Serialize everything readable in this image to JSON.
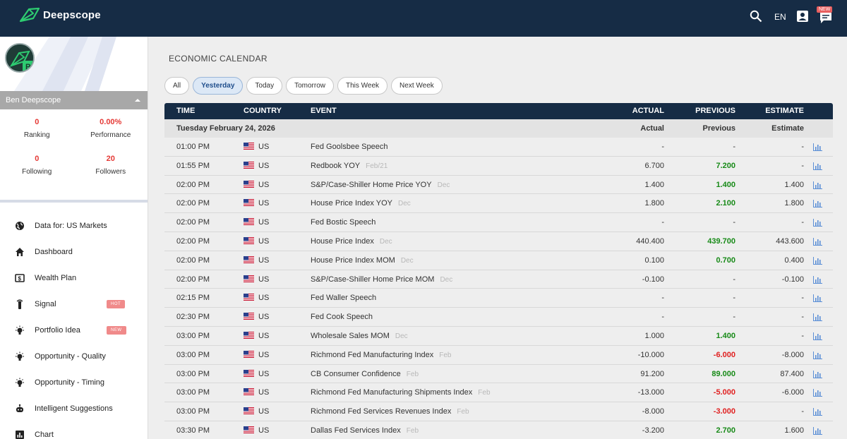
{
  "header": {
    "app_name": "Deepscope",
    "language": "EN",
    "new_badge": "NEW"
  },
  "sidebar": {
    "username": "Ben Deepscope",
    "stats": [
      {
        "value": "0",
        "label": "Ranking"
      },
      {
        "value": "0.00%",
        "label": "Performance"
      },
      {
        "value": "0",
        "label": "Following"
      },
      {
        "value": "20",
        "label": "Followers"
      }
    ],
    "items": [
      {
        "label": "Data for: US Markets",
        "icon": "globe-icon"
      },
      {
        "label": "Dashboard",
        "icon": "home-icon"
      },
      {
        "label": "Wealth Plan",
        "icon": "wallet-icon"
      },
      {
        "label": "Signal",
        "icon": "signal-icon",
        "badge": "HOT"
      },
      {
        "label": "Portfolio Idea",
        "icon": "lightbulb-icon",
        "badge": "NEW"
      },
      {
        "label": "Opportunity - Quality",
        "icon": "lightbulb-icon"
      },
      {
        "label": "Opportunity - Timing",
        "icon": "lightbulb-icon"
      },
      {
        "label": "Intelligent Suggestions",
        "icon": "robot-icon"
      },
      {
        "label": "Chart",
        "icon": "chart-icon"
      }
    ]
  },
  "main": {
    "title": "ECONOMIC CALENDAR",
    "filters": [
      "All",
      "Yesterday",
      "Today",
      "Tomorrow",
      "This Week",
      "Next Week"
    ],
    "active_filter": "Yesterday",
    "columns": {
      "time": "TIME",
      "country": "COUNTRY",
      "event": "EVENT",
      "actual": "ACTUAL",
      "previous": "PREVIOUS",
      "estimate": "ESTIMATE"
    },
    "date_row": {
      "date": "Tuesday February 24, 2026",
      "actual": "Actual",
      "previous": "Previous",
      "estimate": "Estimate"
    },
    "rows": [
      {
        "time": "01:00 PM",
        "country": "US",
        "event": "Fed Goolsbee Speech",
        "period": "",
        "actual": "-",
        "previous": "-",
        "prev_status": "none",
        "estimate": "-"
      },
      {
        "time": "01:55 PM",
        "country": "US",
        "event": "Redbook YOY",
        "period": "Feb/21",
        "actual": "6.700",
        "previous": "7.200",
        "prev_status": "pos",
        "estimate": "-"
      },
      {
        "time": "02:00 PM",
        "country": "US",
        "event": "S&P/Case-Shiller Home Price YOY",
        "period": "Dec",
        "actual": "1.400",
        "previous": "1.400",
        "prev_status": "pos",
        "estimate": "1.400"
      },
      {
        "time": "02:00 PM",
        "country": "US",
        "event": "House Price Index YOY",
        "period": "Dec",
        "actual": "1.800",
        "previous": "2.100",
        "prev_status": "pos",
        "estimate": "1.800"
      },
      {
        "time": "02:00 PM",
        "country": "US",
        "event": "Fed Bostic Speech",
        "period": "",
        "actual": "-",
        "previous": "-",
        "prev_status": "none",
        "estimate": "-"
      },
      {
        "time": "02:00 PM",
        "country": "US",
        "event": "House Price Index",
        "period": "Dec",
        "actual": "440.400",
        "previous": "439.700",
        "prev_status": "pos",
        "estimate": "443.600"
      },
      {
        "time": "02:00 PM",
        "country": "US",
        "event": "House Price Index MOM",
        "period": "Dec",
        "actual": "0.100",
        "previous": "0.700",
        "prev_status": "pos",
        "estimate": "0.400"
      },
      {
        "time": "02:00 PM",
        "country": "US",
        "event": "S&P/Case-Shiller Home Price MOM",
        "period": "Dec",
        "actual": "-0.100",
        "previous": "-",
        "prev_status": "none",
        "estimate": "-0.100"
      },
      {
        "time": "02:15 PM",
        "country": "US",
        "event": "Fed Waller Speech",
        "period": "",
        "actual": "-",
        "previous": "-",
        "prev_status": "none",
        "estimate": "-"
      },
      {
        "time": "02:30 PM",
        "country": "US",
        "event": "Fed Cook Speech",
        "period": "",
        "actual": "-",
        "previous": "-",
        "prev_status": "none",
        "estimate": "-"
      },
      {
        "time": "03:00 PM",
        "country": "US",
        "event": "Wholesale Sales MOM",
        "period": "Dec",
        "actual": "1.000",
        "previous": "1.400",
        "prev_status": "pos",
        "estimate": "-"
      },
      {
        "time": "03:00 PM",
        "country": "US",
        "event": "Richmond Fed Manufacturing Index",
        "period": "Feb",
        "actual": "-10.000",
        "previous": "-6.000",
        "prev_status": "neg",
        "estimate": "-8.000"
      },
      {
        "time": "03:00 PM",
        "country": "US",
        "event": "CB Consumer Confidence",
        "period": "Feb",
        "actual": "91.200",
        "previous": "89.000",
        "prev_status": "pos",
        "estimate": "87.400"
      },
      {
        "time": "03:00 PM",
        "country": "US",
        "event": "Richmond Fed Manufacturing Shipments Index",
        "period": "Feb",
        "actual": "-13.000",
        "previous": "-5.000",
        "prev_status": "neg",
        "estimate": "-6.000"
      },
      {
        "time": "03:00 PM",
        "country": "US",
        "event": "Richmond Fed Services Revenues Index",
        "period": "Feb",
        "actual": "-8.000",
        "previous": "-3.000",
        "prev_status": "neg",
        "estimate": "-"
      },
      {
        "time": "03:30 PM",
        "country": "US",
        "event": "Dallas Fed Services Index",
        "period": "Feb",
        "actual": "-3.200",
        "previous": "2.700",
        "prev_status": "pos",
        "estimate": "1.600"
      }
    ]
  },
  "colors": {
    "header_bg": "#162c45",
    "positive": "#178a17",
    "negative": "#e02020",
    "badge": "#f08a8a"
  }
}
